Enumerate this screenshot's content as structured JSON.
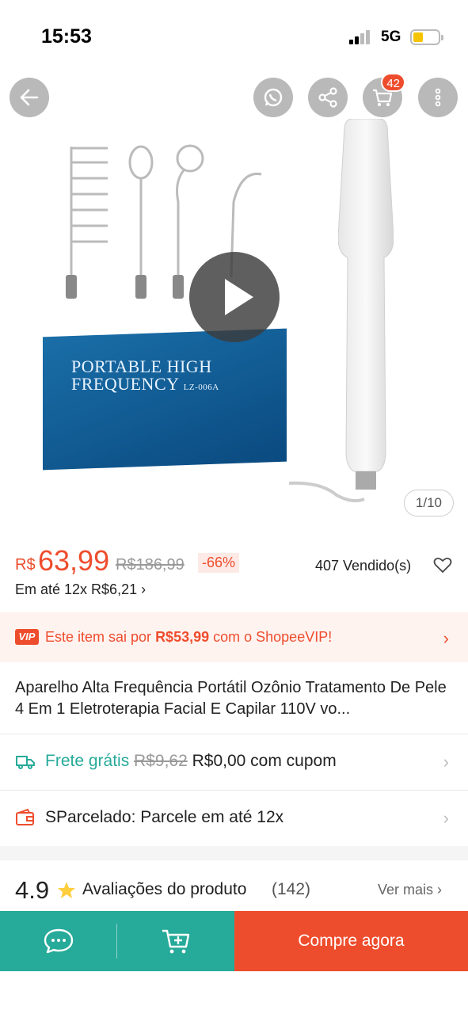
{
  "status_bar": {
    "time": "15:53",
    "network": "5G",
    "battery_level": 0.3
  },
  "gallery": {
    "counter": "1/10",
    "cart_badge": "42",
    "box_text_line1": "PORTABLE HIGH",
    "box_text_line2": "FREQUENCY",
    "box_model": "LZ-006A"
  },
  "price": {
    "currency": "R$",
    "current": "63,99",
    "original": "R$186,99",
    "discount": "-66%",
    "sold": "407 Vendido(s)",
    "installment": "Em até 12x R$6,21 ›"
  },
  "vip": {
    "icon_label": "VIP",
    "text_prefix": "Este item sai por ",
    "vip_price": "R$53,99",
    "text_suffix": " com o ShopeeVIP!"
  },
  "product_title": "Aparelho Alta Frequência Portátil Ozônio Tratamento De Pele 4 Em 1 Eletroterapia Facial E Capilar 110V vo...",
  "shipping": {
    "label": "Frete grátis",
    "old_price": "R$9,62",
    "new_text": "R$0,00 com cupom"
  },
  "sparcelado": {
    "text": "SParcelado: Parcele em até 12x"
  },
  "reviews": {
    "rating": "4.9",
    "label": "Avaliações do produto",
    "count": "(142)",
    "see_more": "Ver mais ›"
  },
  "bottom_bar": {
    "buy_label": "Compre agora"
  },
  "colors": {
    "brand": "#ee4d2d",
    "teal": "#26aa99"
  }
}
